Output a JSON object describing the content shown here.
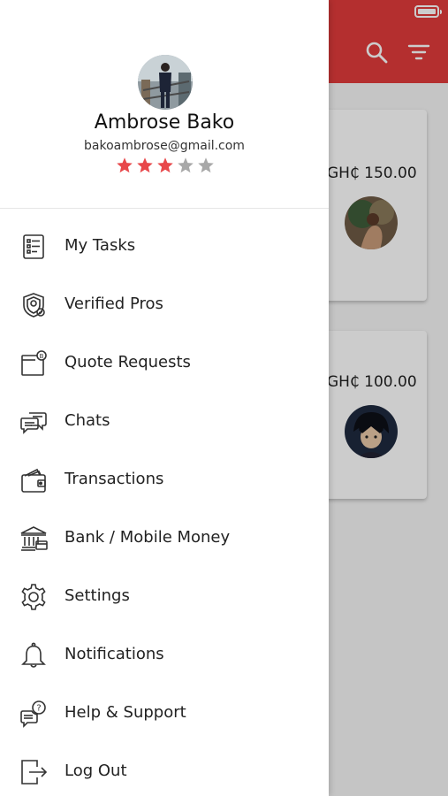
{
  "profile": {
    "name": "Ambrose Bako",
    "email": "bakoambrose@gmail.com",
    "rating": 3,
    "rating_max": 5
  },
  "menu": {
    "items": [
      {
        "label": "My Tasks",
        "icon": "tasks-list-icon"
      },
      {
        "label": "Verified Pros",
        "icon": "shield-badge-icon"
      },
      {
        "label": "Quote Requests",
        "icon": "quote-request-icon"
      },
      {
        "label": "Chats",
        "icon": "chat-bubbles-icon"
      },
      {
        "label": "Transactions",
        "icon": "wallet-icon"
      },
      {
        "label": "Bank / Mobile Money",
        "icon": "bank-icon"
      },
      {
        "label": "Settings",
        "icon": "gear-icon"
      },
      {
        "label": "Notifications",
        "icon": "bell-icon"
      },
      {
        "label": "Help & Support",
        "icon": "help-chat-icon"
      },
      {
        "label": "Log Out",
        "icon": "logout-icon"
      }
    ]
  },
  "background": {
    "cards": [
      {
        "price": "GH₵ 150.00"
      },
      {
        "price": "GH₵ 100.00"
      }
    ]
  },
  "colors": {
    "accent": "#e23b3b",
    "star_filled": "#e8474a",
    "star_empty": "#a8a8a8"
  }
}
